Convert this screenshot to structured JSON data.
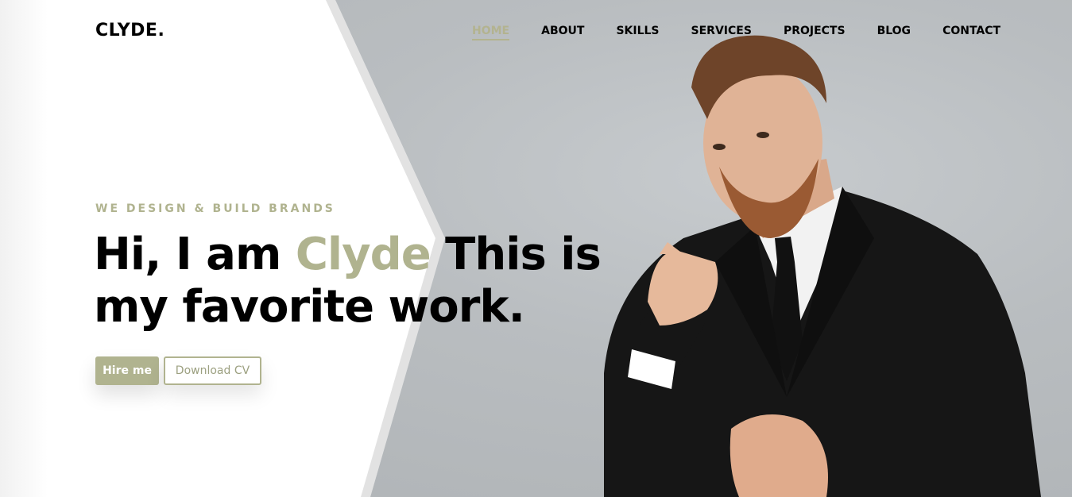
{
  "brand": {
    "logo": "CLYDE."
  },
  "nav": {
    "items": [
      {
        "label": "HOME",
        "active": true
      },
      {
        "label": "ABOUT",
        "active": false
      },
      {
        "label": "SKILLS",
        "active": false
      },
      {
        "label": "SERVICES",
        "active": false
      },
      {
        "label": "PROJECTS",
        "active": false
      },
      {
        "label": "BLOG",
        "active": false
      },
      {
        "label": "CONTACT",
        "active": false
      }
    ]
  },
  "hero": {
    "subtitle": "WE DESIGN & BUILD BRANDS",
    "headline_pre": "Hi, I am ",
    "headline_name": "Clyde",
    "headline_post": " This is my favorite work.",
    "buttons": {
      "primary": "Hire me",
      "secondary": "Download CV"
    }
  },
  "colors": {
    "accent": "#b0b38f",
    "text": "#000000",
    "background": "#ffffff"
  }
}
